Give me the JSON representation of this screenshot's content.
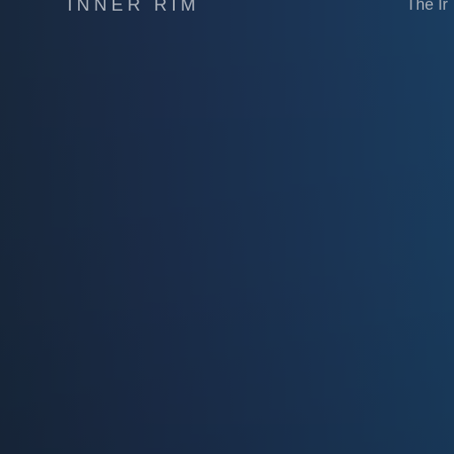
{
  "region": {
    "title": "INNER RIM"
  },
  "description": {
    "text": "The Ir"
  },
  "colors": {
    "background_left": "#18283d",
    "background_right": "#1a3d60",
    "text": "#aeb4bd"
  }
}
